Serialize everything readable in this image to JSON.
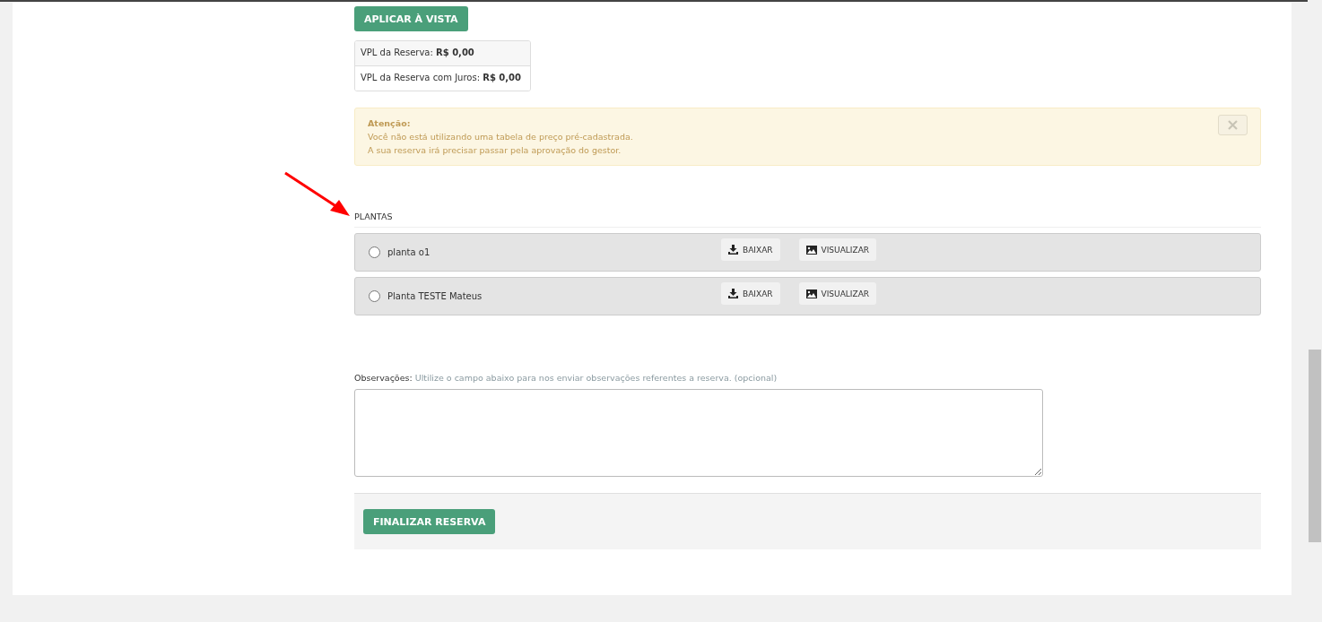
{
  "apply_button": "APLICAR À VISTA",
  "summary": [
    "VPL da Reserva: **R$ 0,00**",
    "VPL da Reserva com Juros: **R$ 0,00**"
  ],
  "alert": {
    "title": "Atenção:",
    "lines": [
      "Você não está utilizando uma tabela de preço pré-cadastrada.",
      "A sua reserva irá precisar passar pela aprovação do gestor."
    ],
    "dismissible": true
  },
  "plans": {
    "title": "PLANTAS",
    "items": [
      {
        "name": "planta o1",
        "selected": false,
        "download": "BAIXAR",
        "view": "VISUALIZAR"
      },
      {
        "name": "Planta TESTE Mateus",
        "selected": false,
        "download": "BAIXAR",
        "view": "VISUALIZAR"
      }
    ]
  },
  "notes": {
    "label": "Observações:",
    "hint": "Ultilize o campo abaixo para nos enviar observações referentes a reserva. (opcional)"
  },
  "finish_button": "FINALIZAR RESERVA"
}
